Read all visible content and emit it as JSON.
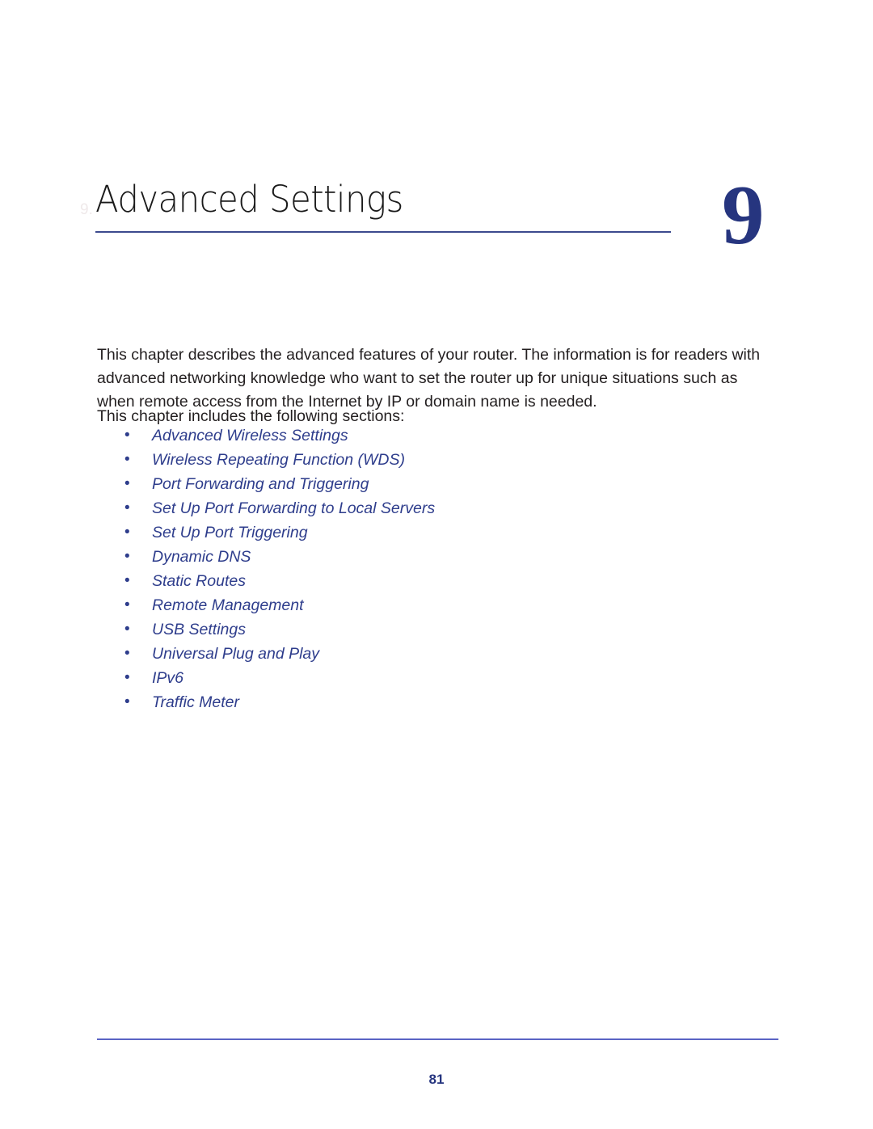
{
  "chapter": {
    "title": "Advanced Settings",
    "number": "9",
    "watermark": "9."
  },
  "body": {
    "intro": "This chapter describes the advanced features of your router. The information is for readers with advanced networking knowledge who want to set the router up for unique situations such as when remote access from the Internet by IP or domain name is needed.",
    "includes_line": "This chapter includes the following sections:"
  },
  "sections": {
    "bullet_glyph": "•",
    "items": [
      {
        "label": "Advanced Wireless Settings"
      },
      {
        "label": "Wireless Repeating Function (WDS)"
      },
      {
        "label": "Port Forwarding and Triggering"
      },
      {
        "label": "Set Up Port Forwarding to Local Servers"
      },
      {
        "label": "Set Up Port Triggering"
      },
      {
        "label": "Dynamic DNS"
      },
      {
        "label": "Static Routes"
      },
      {
        "label": "Remote Management"
      },
      {
        "label": "USB Settings"
      },
      {
        "label": "Universal Plug and Play"
      },
      {
        "label": "IPv6"
      },
      {
        "label": "Traffic Meter"
      }
    ]
  },
  "footer": {
    "page_number": "81"
  },
  "colors": {
    "link_blue": "#2e3d8c",
    "chapter_number_navy": "#26357f",
    "title_rule": "#3c4a8e",
    "footer_rule": "#5a63c4",
    "body_text": "#231f20"
  }
}
